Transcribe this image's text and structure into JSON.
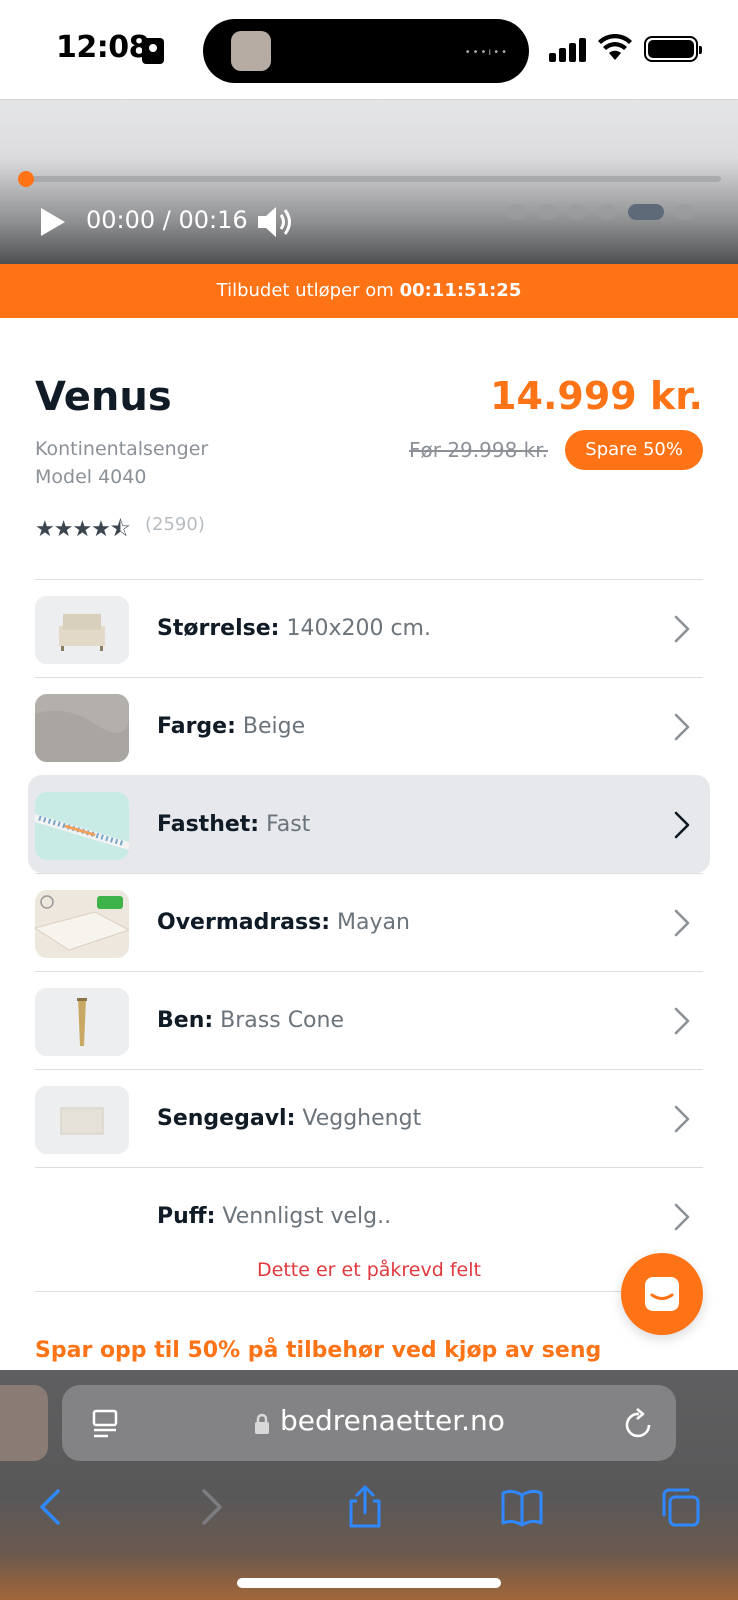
{
  "status_bar": {
    "time": "12:08"
  },
  "video": {
    "time_display": "00:00 / 00:16",
    "progress_fraction": 0.0,
    "carousel_dot_count": 6,
    "carousel_active_index": 4
  },
  "offer_banner": {
    "prefix": "Tilbudet utløper om ",
    "countdown": "00:11:51:25"
  },
  "product": {
    "name": "Venus",
    "category": "Kontinentalsenger",
    "model": "Model 4040",
    "price": "14.999 kr.",
    "old_price": "Før 29.998 kr.",
    "save_badge": "Spare 50%",
    "rating_value": 4.5,
    "rating_count": "(2590)"
  },
  "options": [
    {
      "label": "Størrelse:",
      "value": "140x200 cm.",
      "thumb": "bed-thumbnail"
    },
    {
      "label": "Farge:",
      "value": "Beige",
      "thumb": "fabric-swatch"
    },
    {
      "label": "Fasthet:",
      "value": "Fast",
      "thumb": "mattress-spring-thumbnail",
      "selected": true
    },
    {
      "label": "Overmadrass:",
      "value": "Mayan",
      "thumb": "topper-thumbnail"
    },
    {
      "label": "Ben:",
      "value": "Brass Cone",
      "thumb": "bed-leg-thumbnail"
    },
    {
      "label": "Sengegavl:",
      "value": "Vegghengt",
      "thumb": "headboard-thumbnail"
    },
    {
      "label": "Puff:",
      "value": "Vennligst velg..",
      "thumb": ""
    }
  ],
  "required_note": "Dette er et påkrevd felt",
  "promo_text": "Spar opp til 50% på tilbehør ved kjøp av seng",
  "safari": {
    "url": "bedrenaetter.no"
  },
  "colors": {
    "accent": "#ff7317",
    "text_dark": "#101b26",
    "text_muted": "#8b9197",
    "error": "#e0383c",
    "selected_row": "#e6e8eb"
  }
}
